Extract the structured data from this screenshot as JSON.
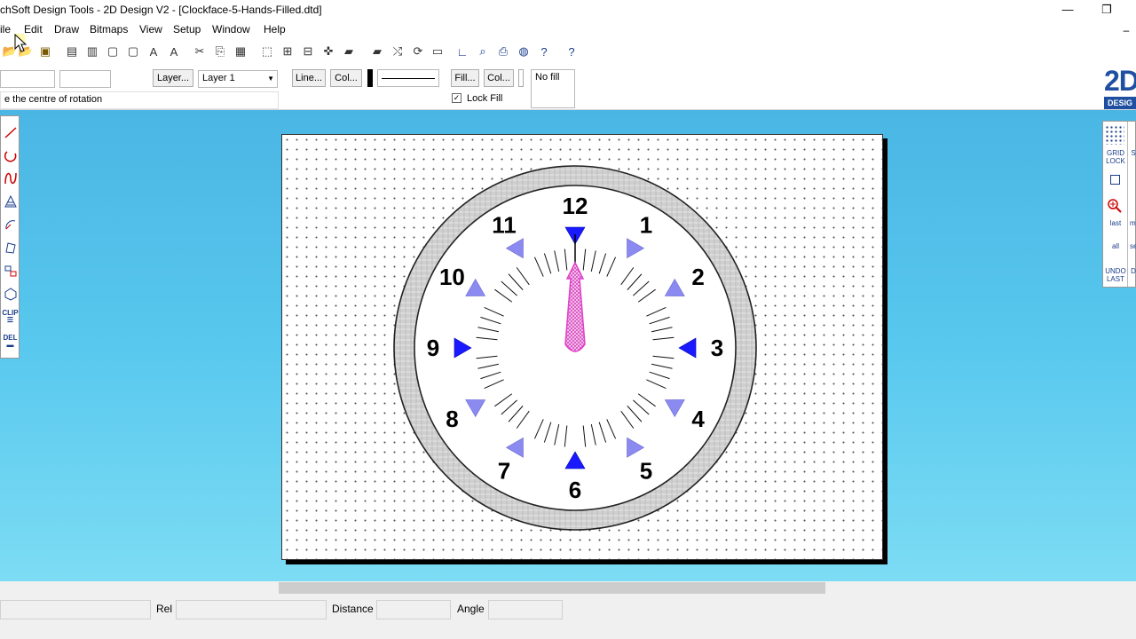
{
  "window": {
    "title": "chSoft Design Tools - 2D Design V2 - [Clockface-5-Hands-Filled.dtd]",
    "minimize_glyph": "—",
    "restore_glyph": "❐"
  },
  "menu": {
    "items": [
      "ile",
      "Edit",
      "Draw",
      "Bitmaps",
      "View",
      "Setup",
      "Window",
      "Help"
    ],
    "mdi_minimize": "–",
    "mdi_restore": "❐"
  },
  "toolbar": {
    "icons": [
      "open-folder-icon",
      "open-icon",
      "save-icon",
      "print-setup-icon",
      "print-icon",
      "page-icon",
      "page-copy-icon",
      "text-icon",
      "text-style-icon",
      "cut-icon",
      "copy-icon",
      "paste-icon",
      "select-icon",
      "group-icon",
      "align-icon",
      "center-icon",
      "arrange-back-icon",
      "arrange-front-icon",
      "flip-icon",
      "rotate-icon",
      "rectangle-view-icon",
      "axes-icon",
      "zoom-icon",
      "print-preview-icon",
      "globe-icon",
      "context-help-icon",
      "help-icon"
    ]
  },
  "attributes": {
    "coord_x": "",
    "coord_y": "",
    "layer_button": "Layer...",
    "layer_select": "Layer 1",
    "line_button": "Line...",
    "line_colour_button": "Col...",
    "fill_button": "Fill...",
    "fill_colour_button": "Col...",
    "fill_preview": "No fill",
    "lock_fill_label": "Lock Fill",
    "lock_fill_checked": true,
    "prompt": "e the centre of rotation"
  },
  "left_tools": {
    "clip_label": "CLIP",
    "del_label": "DEL"
  },
  "right_tools": {
    "grid_lock": "GRID LOCK",
    "last": "last",
    "all": "all",
    "undo_last": "UNDO LAST",
    "zoom_label": "me",
    "se_label": "se",
    "s_label": "S",
    "l_label": "L",
    "d_label": "D"
  },
  "logo": {
    "text": "2D",
    "subtext": "DESIG"
  },
  "clock": {
    "numbers": [
      "12",
      "1",
      "2",
      "3",
      "4",
      "5",
      "6",
      "7",
      "8",
      "9",
      "10",
      "11"
    ],
    "marker_color_major": "#1a1aff",
    "marker_color_minor": "#8a8af0",
    "hand_color": "#e040c8",
    "rim_color": "#c8c8c8"
  },
  "status": {
    "rel_label": "Rel",
    "distance_label": "Distance",
    "angle_label": "Angle",
    "rel_value": "",
    "distance_value": "",
    "angle_value": ""
  }
}
